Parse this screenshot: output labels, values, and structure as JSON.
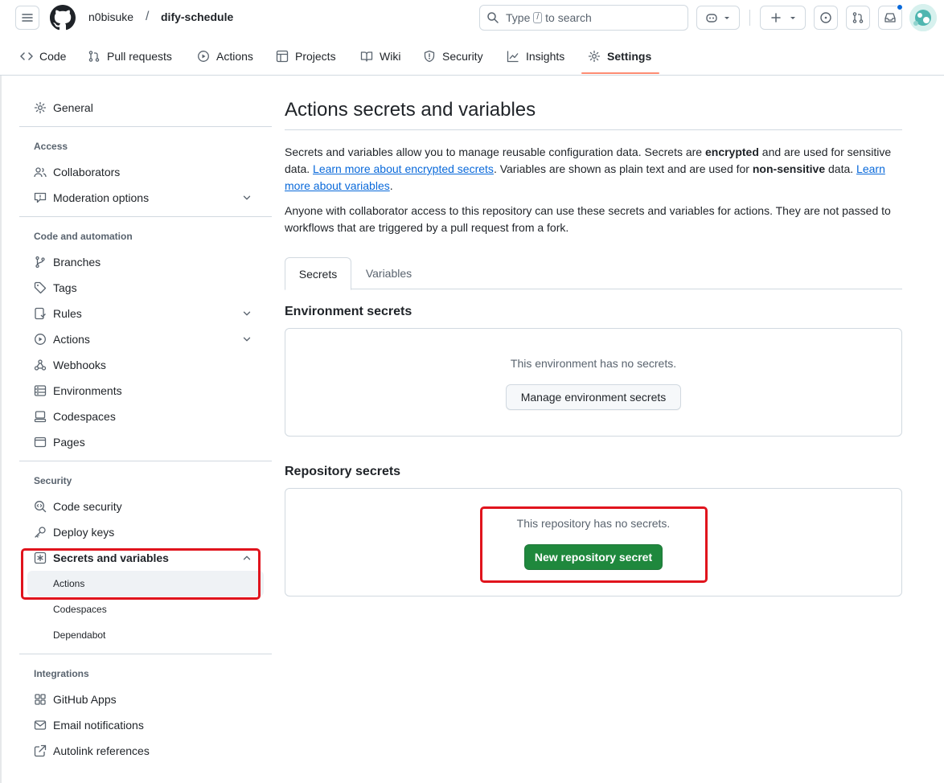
{
  "colors": {
    "accent_link": "#0969da",
    "primary_button": "#1f883d",
    "nav_underline": "#fd8c73",
    "annotation_red": "#e0141d"
  },
  "header": {
    "owner": "n0bisuke",
    "separator": "/",
    "repo": "dify-schedule",
    "search_prefix": "Type",
    "search_key": "/",
    "search_suffix": "to search",
    "icons": [
      "menu-icon",
      "github-logo-icon",
      "search-icon",
      "copilot-icon",
      "chevron-down-icon",
      "plus-icon",
      "issues-icon",
      "pull-request-icon",
      "inbox-icon",
      "avatar"
    ]
  },
  "repo_nav": {
    "items": [
      {
        "label": "Code",
        "icon": "code-icon"
      },
      {
        "label": "Pull requests",
        "icon": "pull-request-icon"
      },
      {
        "label": "Actions",
        "icon": "play-icon"
      },
      {
        "label": "Projects",
        "icon": "table-icon"
      },
      {
        "label": "Wiki",
        "icon": "book-icon"
      },
      {
        "label": "Security",
        "icon": "shield-icon"
      },
      {
        "label": "Insights",
        "icon": "graph-icon"
      },
      {
        "label": "Settings",
        "icon": "gear-icon",
        "active": true
      }
    ]
  },
  "sidebar": {
    "general": "General",
    "access_heading": "Access",
    "collaborators": "Collaborators",
    "moderation": "Moderation options",
    "code_heading": "Code and automation",
    "branches": "Branches",
    "tags": "Tags",
    "rules": "Rules",
    "actions": "Actions",
    "webhooks": "Webhooks",
    "environments": "Environments",
    "codespaces": "Codespaces",
    "pages": "Pages",
    "security_heading": "Security",
    "code_security": "Code security",
    "deploy_keys": "Deploy keys",
    "secrets_vars": "Secrets and variables",
    "sub_actions": "Actions",
    "sub_codespaces": "Codespaces",
    "sub_dependabot": "Dependabot",
    "integrations_heading": "Integrations",
    "github_apps": "GitHub Apps",
    "email_notifications": "Email notifications",
    "autolink": "Autolink references"
  },
  "main": {
    "title": "Actions secrets and variables",
    "p1_a": "Secrets and variables allow you to manage reusable configuration data. Secrets are ",
    "p1_b": "encrypted",
    "p1_c": " and are used for sensitive data. ",
    "p1_link1": "Learn more about encrypted secrets",
    "p1_d": ". Variables are shown as plain text and are used for ",
    "p1_e": "non-sensitive",
    "p1_f": " data. ",
    "p1_link2": "Learn more about variables",
    "p1_g": ".",
    "p2": "Anyone with collaborator access to this repository can use these secrets and variables for actions. They are not passed to workflows that are triggered by a pull request from a fork.",
    "tab_secrets": "Secrets",
    "tab_variables": "Variables",
    "env_heading": "Environment secrets",
    "env_empty": "This environment has no secrets.",
    "env_button": "Manage environment secrets",
    "repo_heading": "Repository secrets",
    "repo_empty": "This repository has no secrets.",
    "repo_button": "New repository secret"
  }
}
